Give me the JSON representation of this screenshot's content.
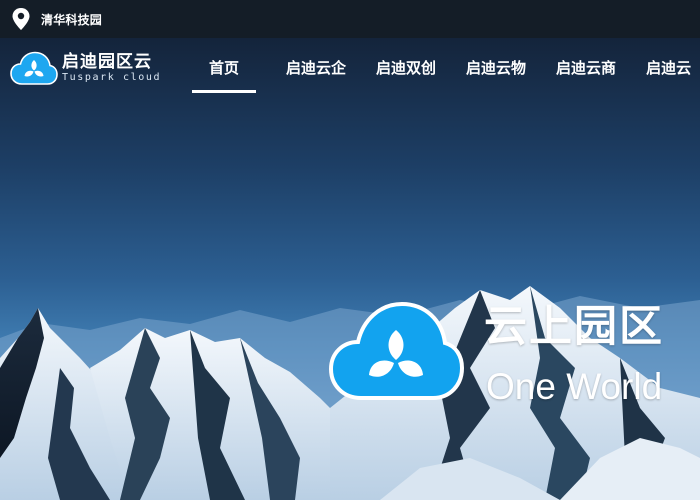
{
  "topbar": {
    "location_icon": "map-pin-icon",
    "location": "清华科技园"
  },
  "brand": {
    "icon": "cloud-trillium-logo-icon",
    "name_cn": "启迪园区云",
    "name_en": "Tuspark cloud"
  },
  "nav": {
    "items": [
      {
        "label": "首页",
        "active": true
      },
      {
        "label": "启迪云企"
      },
      {
        "label": "启迪双创"
      },
      {
        "label": "启迪云物"
      },
      {
        "label": "启迪云商"
      },
      {
        "label": "启迪云"
      }
    ]
  },
  "hero": {
    "icon": "cloud-trillium-logo-icon",
    "slogan_cn": "云上园区",
    "slogan_en": "One World"
  },
  "colors": {
    "topbar_bg": "#141d27",
    "brand_blue": "#1ea7f0",
    "text": "#ffffff"
  }
}
